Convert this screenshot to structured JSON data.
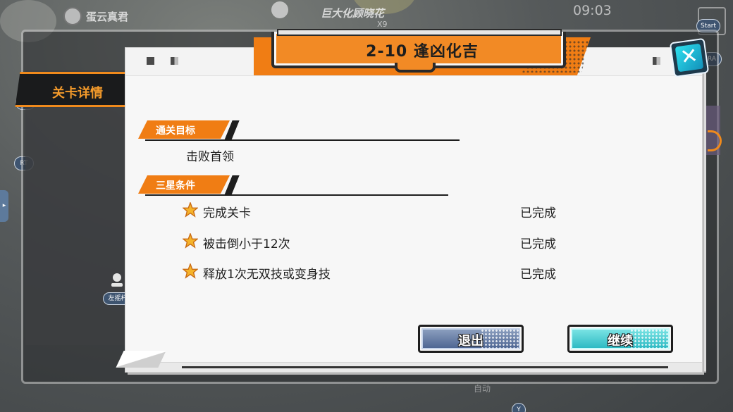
{
  "hud": {
    "location_label": "蛋云真君",
    "boss_name": "巨大化顾晓花",
    "boss_count": "X9",
    "timer": "09:03",
    "auto_label": "自动",
    "badges": {
      "start": "Start",
      "ra": "RA",
      "lt": "LT",
      "rt": "RT",
      "y": "Y",
      "left_stick": "左摇杆"
    }
  },
  "side_tab": {
    "label": "关卡详情"
  },
  "dialog": {
    "title": "2-10 逢凶化吉",
    "clear_goal": {
      "header": "通关目标",
      "text": "击败首领"
    },
    "three_star": {
      "header": "三星条件",
      "conditions": [
        {
          "text": "完成关卡",
          "status": "已完成"
        },
        {
          "text": "被击倒小于12次",
          "status": "已完成"
        },
        {
          "text": "释放1次无双技或变身技",
          "status": "已完成"
        }
      ]
    },
    "buttons": {
      "exit_label": "退出",
      "continue_label": "继续",
      "close_icon": "x-icon"
    }
  },
  "colors": {
    "accent_orange": "#f07d14",
    "exit_blue": "#4a6290",
    "continue_cyan": "#28b7c1",
    "close_cyan": "#2ce0ef"
  }
}
